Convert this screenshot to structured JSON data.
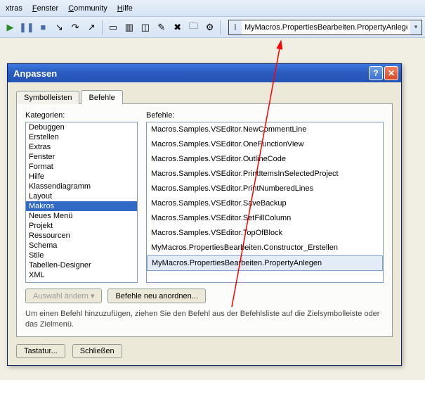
{
  "menu": {
    "items": [
      {
        "label": "xtras",
        "accel": "x"
      },
      {
        "label": "Fenster",
        "accel": "F"
      },
      {
        "label": "Community",
        "accel": "C"
      },
      {
        "label": "Hilfe",
        "accel": "H"
      }
    ]
  },
  "toolbar": {
    "macro_value": "MyMacros.PropertiesBearbeiten.PropertyAnlegen"
  },
  "dialog": {
    "title": "Anpassen",
    "tabs": {
      "toolbars": "Symbolleisten",
      "commands": "Befehle"
    },
    "labels": {
      "categories": "Kategorien:",
      "commands": "Befehle:",
      "modify_selection": "Auswahl ändern",
      "rearrange": "Befehle neu anordnen...",
      "hint": "Um einen Befehl hinzuzufügen, ziehen Sie den Befehl aus der Befehlsliste auf die Zielsymbolleiste oder das Zielmenü.",
      "keyboard": "Tastatur...",
      "close": "Schließen"
    },
    "categories": [
      "Debuggen",
      "Erstellen",
      "Extras",
      "Fenster",
      "Format",
      "Hilfe",
      "Klassendiagramm",
      "Layout",
      "Makros",
      "Neues Menü",
      "Projekt",
      "Ressourcen",
      "Schema",
      "Stile",
      "Tabellen-Designer",
      "XML"
    ],
    "categories_selected": "Makros",
    "commands": [
      "Macros.Samples.VSEditor.NewCommentLine",
      "Macros.Samples.VSEditor.OneFunctionView",
      "Macros.Samples.VSEditor.OutlineCode",
      "Macros.Samples.VSEditor.PrintItemsInSelectedProject",
      "Macros.Samples.VSEditor.PrintNumberedLines",
      "Macros.Samples.VSEditor.SaveBackup",
      "Macros.Samples.VSEditor.SetFillColumn",
      "Macros.Samples.VSEditor.TopOfBlock",
      "MyMacros.PropertiesBearbeiten.Constructor_Erstellen",
      "MyMacros.PropertiesBearbeiten.PropertyAnlegen"
    ],
    "commands_highlighted": "MyMacros.PropertiesBearbeiten.PropertyAnlegen"
  }
}
